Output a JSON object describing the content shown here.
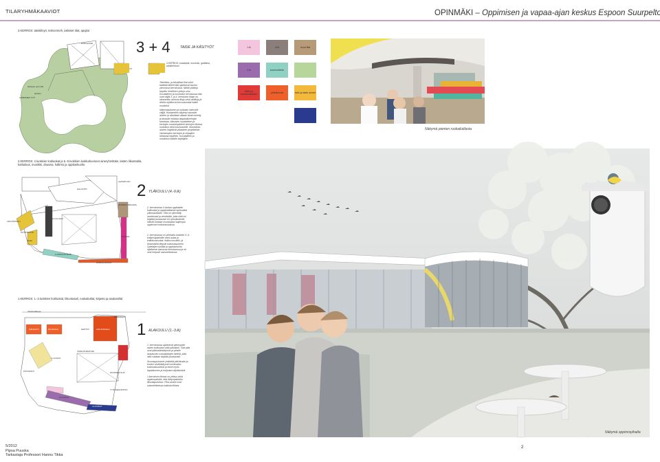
{
  "header": {
    "left_title": "TILARYHMÄKAAVIOT",
    "right_title_main": "OPINMÄKI – ",
    "right_title_sub": "Oppimisen ja vapaa-ajan keskus Espoon Suurpeltoon"
  },
  "section3": {
    "plan_title": "3.KERROS: taksitilnyö, teknonmoh, taksiset tilat, apujtat",
    "number": "3 + 4",
    "title": "TAIDE JA KÄSITYÖT",
    "sub_title": "4.KERROS: kuvataide, muotoilu, grafiikka, arkkitehtuuri",
    "paragraph1": "Tekniikka- ja tekstiiliset tilat sekä taidetarvikkeet tilat sijaitsevat koulun ylimmissä kerroksissa. Näiltä ylätiloja tarjoiltu rehellinen yhteys ulos. Kuvataiteen ja muotoilun kerroksissa tilat ovat väljät 3. ja 4. kerroksen tilaan on rakennettu avoimia tiloja sekä välitiloja ja tiloihin sijoittuvat luovuusluokat kaikki muotoilut.",
    "paragraph2": "Näkemäsalueen ja ruokalan lokeroille väljät. Hukkareiten käytetyt saunalle alueen ja ulkotilaan alkaan tämä rinnetty ja terasille erilaista iltapäiväkerhojen toimintaa. Aikuisten kuvataiteen ja kerhojen muotoilupisteet kerhojen tiloissa ruokailun sekä koululuokille. Muotoiluta-alueen käyttävät yläasteen projekteihin. Vanhempien kerhojen ja ohjaajien loistavaa käyttöön. Kuvataiteen ja muotoilun kaikille käyttäjille.",
    "plan_labels": [
      "kirkkoportaat",
      "TEKSTIILITYÖ",
      "TEKNIIKKA",
      "teknisen työn tilat",
      "apuiset",
      "LOMINNEN TYÖ"
    ],
    "swatches": [
      {
        "label": "1.lk",
        "color": "#f4c6dd"
      },
      {
        "label": "4.lk",
        "color": "#8a7f7a"
      },
      {
        "label": "muut tilat",
        "color": "#b79a78"
      },
      {
        "label": "2.lk",
        "color": "#9a6cae"
      },
      {
        "label": "luonnontiede",
        "color": "#8fd2c4"
      },
      {
        "label": "",
        "color": "#b6d69c"
      },
      {
        "label": "kielet ja kommunikaatio",
        "color": "#e03b36"
      },
      {
        "label": "yhteiskunta",
        "color": "#ef5f2a"
      },
      {
        "label": "taito ja taide aineet",
        "color": "#f3b93a"
      },
      {
        "label": "",
        "color": "#2a3a8e"
      }
    ],
    "photo_caption": "Näkymä pienten ruokailutilasta"
  },
  "section2": {
    "plan_title": "2.KERROS: 4.luokkien kotiluokat ja 5.-9.luokkien luokkahuoneet aineryhmittäin, lasten liikuntatila, kotitalous, musiikki, draama, hallinto ja oppilashuolto",
    "number": "2",
    "title": "YLÄKOULU (4.-9.lk)",
    "paragraph1": "2. kerroksessa 4.luokan oppilaiden kotiluokat ja oppiaineittaiset opetustilat yläkoululaisille. Tilat on ryhmitelty luontevasti ja vierekkäin, jotta niitä voi käyttää joustavasti eri ryhmäkokoille. Näistä voidaan muodostaa laajempia oppimisen kokonaisuuksia.",
    "paragraph2": "2. kerroksessa on yhteistila luokkien 5.-9. kotipesäpaikoille sekä aulaa ja kotitalousluokat, lisäksi musiikki- ja draamatilat liittyvät kokonaisuuteen. Opettajien työtilat ja oppilashuolto sijaitsevat samassa kerroksessa ja ne ovat helposti saavutettavissa.",
    "plan_labels": [
      "HALLINTO",
      "oppilashuolto",
      "MUSIIKKI DRAAMA",
      "KOTITALOUS",
      "LIIKUNTASALI",
      "LUONNONTIEDE",
      "ROBOLUOKKAT",
      "luonnontieto",
      "kielet",
      "kuvataide"
    ],
    "photo_caption": "Näkymä oppimispihalta"
  },
  "section1": {
    "plan_title": "1.KERROS: 1.-3.luokkien kotiluokat, liikuntasali, ruokailutilat, kirjasto ja asukastilat",
    "number": "1",
    "title": "ALAKOULU (1.-3.lk)",
    "paragraph1": "1. kerroksessa sijaitsevat pienimpien lasten kotiluokat sekä päiväkoti. Tilat joita ovat pääsisäänkäynnin ja pihalle avautuvien ruokailutilojen lähellä, jotta niitä voidaan käyttää joustavasti.",
    "paragraph2": "Suurrappuhuone yhdistää päiväkodin ja koulun sisäänkäynnit luontevaksi kokonaisuudeksi ja toimii myös tapahtumien ja esitysten näyttämönä.",
    "paragraph3": "1.kerroksen tiloista on yhteys sekä oppimispihalle, että lähiympäristön liikuntapuistoon. Piha-alueet ovat saavutettavissa kaikista tiloista.",
    "plan_labels": [
      "KIRJASTO",
      "RUOKAILU",
      "KEITTIÖ",
      "LIIKUNTASALI",
      "1.LUOKAT",
      "2.LUOKAT",
      "3.LUOKAT",
      "PÄIVÄKOTI",
      "TAPAHTUMATORI",
      "NUORISOTILAT",
      "TYÖVÄENOPISTO",
      "urheiluvälineet",
      "sisäänkäynti"
    ]
  },
  "footer": {
    "date": "5/2012",
    "author": "Pipsa Puuska",
    "supervisor": "Tarkastaja Professori Hannu Tikka",
    "page": "2"
  }
}
